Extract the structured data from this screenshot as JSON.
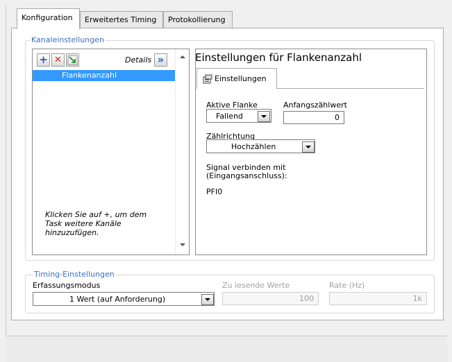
{
  "tabs": [
    {
      "label": "Konfiguration",
      "active": true
    },
    {
      "label": "Erweitertes Timing",
      "active": false
    },
    {
      "label": "Protokollierung",
      "active": false
    }
  ],
  "channel_group": {
    "title": "Kanaleinstellungen",
    "toolbar": {
      "add_symbol": "+",
      "remove_symbol": "✕",
      "details_label": "Details",
      "details_symbol": "»"
    },
    "channels": [
      "Flankenanzahl"
    ],
    "hint": "Klicken Sie auf +, um dem Task weitere Kanäle hinzuzufügen."
  },
  "settings": {
    "title": "Einstellungen für Flankenanzahl",
    "tab_label": "Einstellungen",
    "active_edge_label": "Aktive Flanke",
    "active_edge_value": "Fallend",
    "initial_count_label": "Anfangszählwert",
    "initial_count_value": "0",
    "count_direction_label": "Zählrichtung",
    "count_direction_value": "Hochzählen",
    "signal_label": "Signal verbinden mit (Eingangsanschluss):",
    "signal_value": "PFI0"
  },
  "timing": {
    "title": "Timing-Einstellungen",
    "mode_label": "Erfassungsmodus",
    "mode_value": "1 Wert (auf Anforderung)",
    "samples_label": "Zu lesende Werte",
    "samples_value": "100",
    "rate_label": "Rate (Hz)",
    "rate_value": "1k"
  },
  "colors": {
    "accent": "#3b6fc4",
    "selection": "#3399ff",
    "add_icon": "#1f5fc8",
    "remove_icon": "#d22020"
  }
}
